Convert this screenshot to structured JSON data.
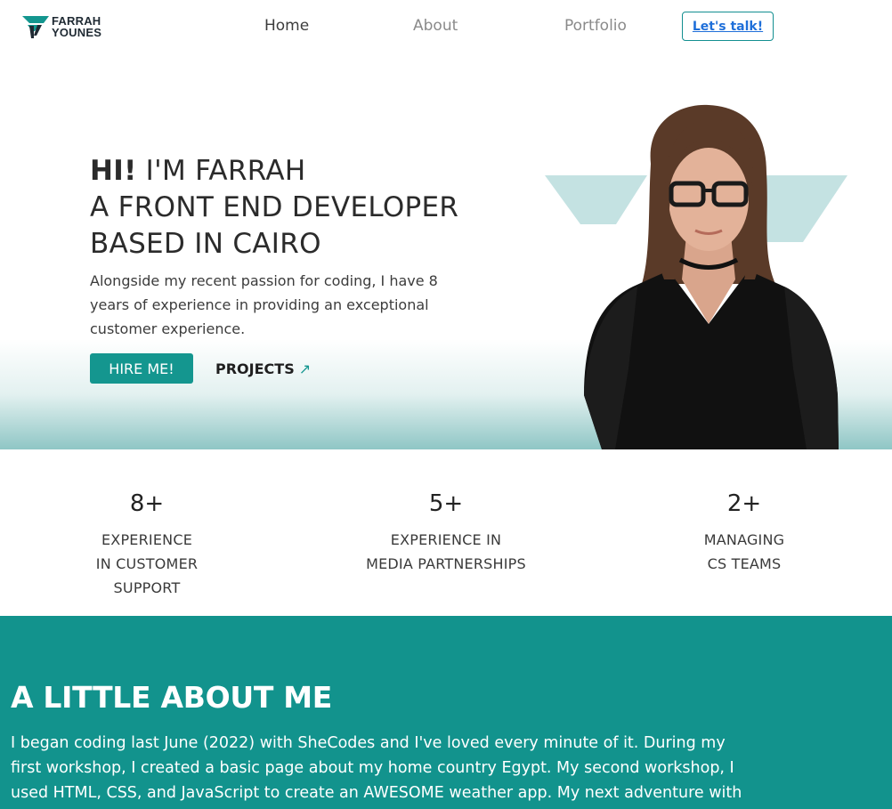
{
  "nav": {
    "logo_line1": "FARRAH",
    "logo_line2": "YOUNES",
    "links": [
      "Home",
      "About",
      "Portfolio"
    ],
    "cta_label": "Let's talk!"
  },
  "hero": {
    "greeting_bold": "HI!",
    "greeting_rest": " I'M FARRAH",
    "title_line2": "A FRONT END DEVELOPER",
    "title_line3": "BASED IN CAIRO",
    "description": "Alongside my recent passion for coding, I have 8 years of experience in providing an exceptional customer experience.",
    "hire_label": "HIRE ME!",
    "projects_label": "PROJECTS",
    "projects_arrow": "↗"
  },
  "stats": [
    {
      "number": "8+",
      "label_lines": [
        "EXPERIENCE",
        "IN CUSTOMER",
        "SUPPORT"
      ]
    },
    {
      "number": "5+",
      "label_lines": [
        "EXPERIENCE IN",
        "MEDIA PARTNERSHIPS"
      ]
    },
    {
      "number": "2+",
      "label_lines": [
        "MANAGING",
        "CS TEAMS"
      ]
    }
  ],
  "about": {
    "title": "A LITTLE ABOUT ME",
    "text": "I began coding last June (2022) with SheCodes and I've loved every minute of it. During my first workshop, I created a basic page about my home country Egypt. My second workshop, I used HTML, CSS, and JavaScript to create an AWESOME weather app. My next adventure with"
  },
  "colors": {
    "brand_teal": "#12938d",
    "button_teal": "#14968f",
    "cta_text_blue": "#1f6fd9",
    "light_teal_mark": "#c4e2e2"
  }
}
